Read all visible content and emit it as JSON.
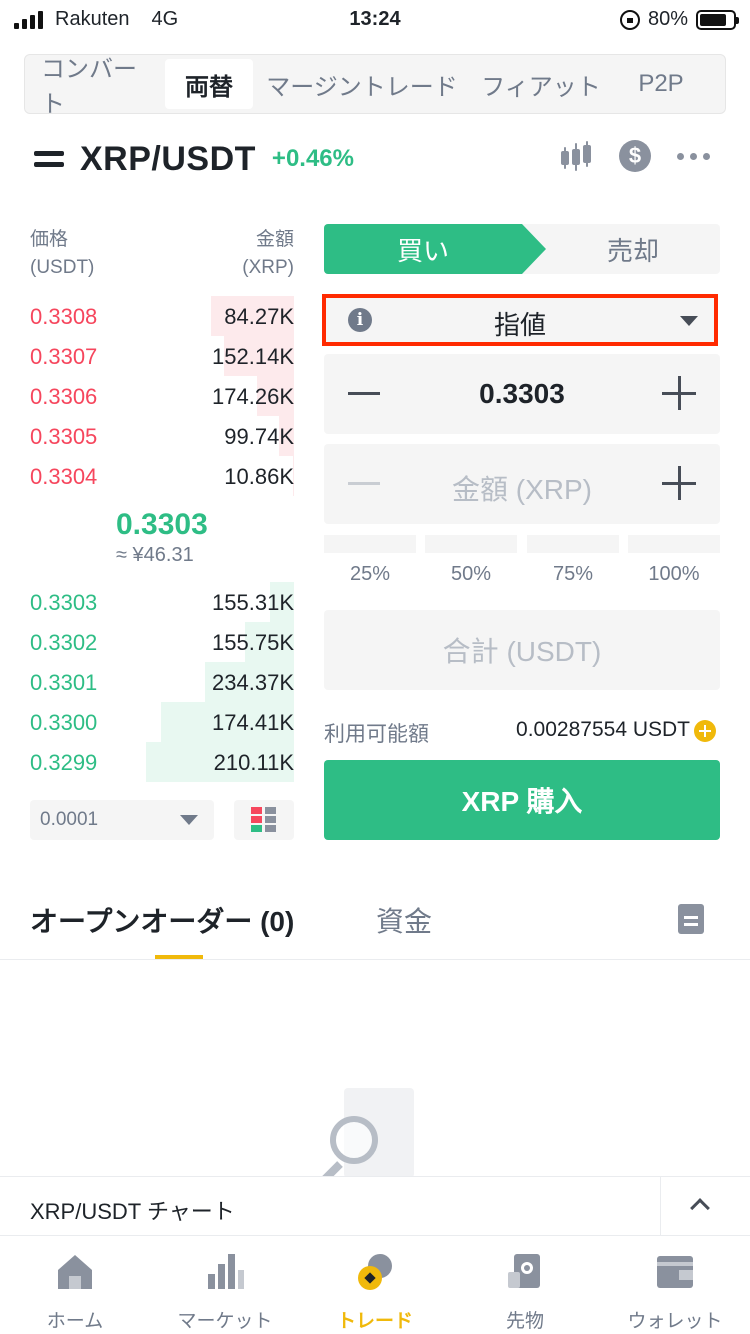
{
  "status": {
    "carrier": "Rakuten",
    "network": "4G",
    "time": "13:24",
    "battery": "80%"
  },
  "top_tabs": [
    {
      "label": "コンバート",
      "active": false
    },
    {
      "label": "両替",
      "active": true
    },
    {
      "label": "マージントレード",
      "active": false
    },
    {
      "label": "フィアット",
      "active": false
    },
    {
      "label": "P2P",
      "active": false
    }
  ],
  "pair": {
    "symbol": "XRP/USDT",
    "change": "+0.46%"
  },
  "order_book": {
    "price_header": "価格",
    "price_unit": "(USDT)",
    "amount_header": "金額",
    "amount_unit": "(XRP)",
    "asks": [
      {
        "price": "0.3308",
        "amount": "84.27K",
        "depth": 0.56
      },
      {
        "price": "0.3307",
        "amount": "152.14K",
        "depth": 0.47
      },
      {
        "price": "0.3306",
        "amount": "174.26K",
        "depth": 0.25
      },
      {
        "price": "0.3305",
        "amount": "99.74K",
        "depth": 0.1
      },
      {
        "price": "0.3304",
        "amount": "10.86K",
        "depth": 0.01
      }
    ],
    "mid_price": "0.3303",
    "mid_fiat": "≈ ¥46.31",
    "bids": [
      {
        "price": "0.3303",
        "amount": "155.31K",
        "depth": 0.16
      },
      {
        "price": "0.3302",
        "amount": "155.75K",
        "depth": 0.33
      },
      {
        "price": "0.3301",
        "amount": "234.37K",
        "depth": 0.6
      },
      {
        "price": "0.3300",
        "amount": "174.41K",
        "depth": 0.9
      },
      {
        "price": "0.3299",
        "amount": "210.11K",
        "depth": 1.0
      }
    ],
    "precision": "0.0001"
  },
  "form": {
    "buy_label": "買い",
    "sell_label": "売却",
    "order_type": "指値",
    "price_value": "0.3303",
    "amount_placeholder": "金額 (XRP)",
    "percents": [
      "25%",
      "50%",
      "75%",
      "100%"
    ],
    "total_placeholder": "合計 (USDT)",
    "available_label": "利用可能額",
    "available_value": "0.00287554 USDT",
    "submit_label": "XRP 購入"
  },
  "orders": {
    "open_tab": "オープンオーダー (0)",
    "funds_tab": "資金"
  },
  "chart_bar": {
    "label": "XRP/USDT チャート"
  },
  "bottom_nav": [
    {
      "label": "ホーム",
      "icon": "home-icon",
      "active": false
    },
    {
      "label": "マーケット",
      "icon": "market-icon",
      "active": false
    },
    {
      "label": "トレード",
      "icon": "trade-icon",
      "active": true
    },
    {
      "label": "先物",
      "icon": "futures-icon",
      "active": false
    },
    {
      "label": "ウォレット",
      "icon": "wallet-icon",
      "active": false
    }
  ],
  "colors": {
    "green": "#2ebd85",
    "red": "#f6465d",
    "accent": "#f0b90b",
    "highlight_border": "#ff2a00"
  }
}
